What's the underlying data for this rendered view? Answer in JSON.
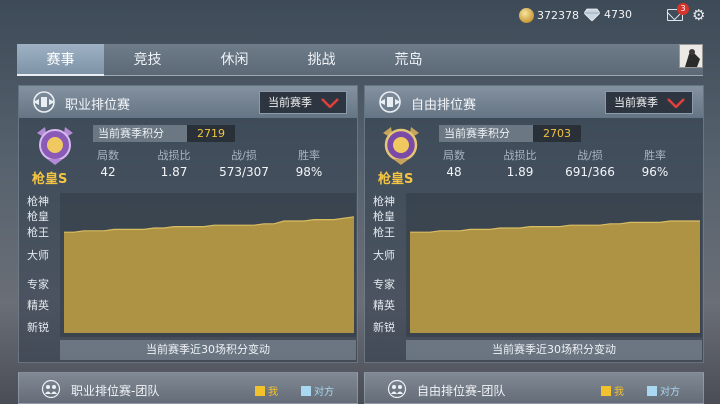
{
  "topbar": {
    "gold": "372378",
    "diamond": "4730",
    "mail_badge": "3"
  },
  "tabs": [
    {
      "label": "赛事",
      "active": true
    },
    {
      "label": "竞技",
      "active": false
    },
    {
      "label": "休闲",
      "active": false
    },
    {
      "label": "挑战",
      "active": false
    },
    {
      "label": "荒岛",
      "active": false
    }
  ],
  "panels": [
    {
      "title": "职业排位赛",
      "season_select": "当前赛季",
      "rank_name": "枪皇S",
      "score_label": "当前赛季积分",
      "score": "2719",
      "stats": [
        {
          "label": "局数",
          "value": "42"
        },
        {
          "label": "战损比",
          "value": "1.87"
        },
        {
          "label": "战/损",
          "value": "573/307"
        },
        {
          "label": "胜率",
          "value": "98%"
        }
      ],
      "tiers": [
        "枪神",
        "枪皇",
        "枪王",
        "大师",
        "专家",
        "精英",
        "新锐"
      ],
      "caption": "当前赛季近30场积分变动",
      "chart_data": {
        "type": "area",
        "points": [
          0.72,
          0.72,
          0.73,
          0.73,
          0.73,
          0.74,
          0.74,
          0.74,
          0.74,
          0.75,
          0.75,
          0.76,
          0.76,
          0.76,
          0.76,
          0.77,
          0.77,
          0.77,
          0.77,
          0.77,
          0.78,
          0.78,
          0.8,
          0.8,
          0.8,
          0.81,
          0.81,
          0.81,
          0.82,
          0.83
        ],
        "color": "#b89a43"
      }
    },
    {
      "title": "自由排位赛",
      "season_select": "当前赛季",
      "rank_name": "枪皇S",
      "score_label": "当前赛季积分",
      "score": "2703",
      "stats": [
        {
          "label": "局数",
          "value": "48"
        },
        {
          "label": "战损比",
          "value": "1.89"
        },
        {
          "label": "战/损",
          "value": "691/366"
        },
        {
          "label": "胜率",
          "value": "96%"
        }
      ],
      "tiers": [
        "枪神",
        "枪皇",
        "枪王",
        "大师",
        "专家",
        "精英",
        "新锐"
      ],
      "caption": "当前赛季近30场积分变动",
      "chart_data": {
        "type": "area",
        "points": [
          0.72,
          0.72,
          0.72,
          0.73,
          0.73,
          0.73,
          0.74,
          0.74,
          0.74,
          0.75,
          0.75,
          0.75,
          0.76,
          0.76,
          0.76,
          0.76,
          0.77,
          0.77,
          0.77,
          0.77,
          0.78,
          0.78,
          0.79,
          0.79,
          0.79,
          0.79,
          0.8,
          0.8,
          0.8,
          0.8
        ],
        "color": "#b89a43"
      }
    }
  ],
  "teams": [
    {
      "title": "职业排位赛-团队",
      "legend_me": "我",
      "legend_opp": "对方"
    },
    {
      "title": "自由排位赛-团队",
      "legend_me": "我",
      "legend_opp": "对方"
    }
  ],
  "colors": {
    "me": "#f2c22e",
    "opponent": "#a9d8f2",
    "gold_text": "#f3c33e",
    "accent_red": "#d8332b"
  }
}
